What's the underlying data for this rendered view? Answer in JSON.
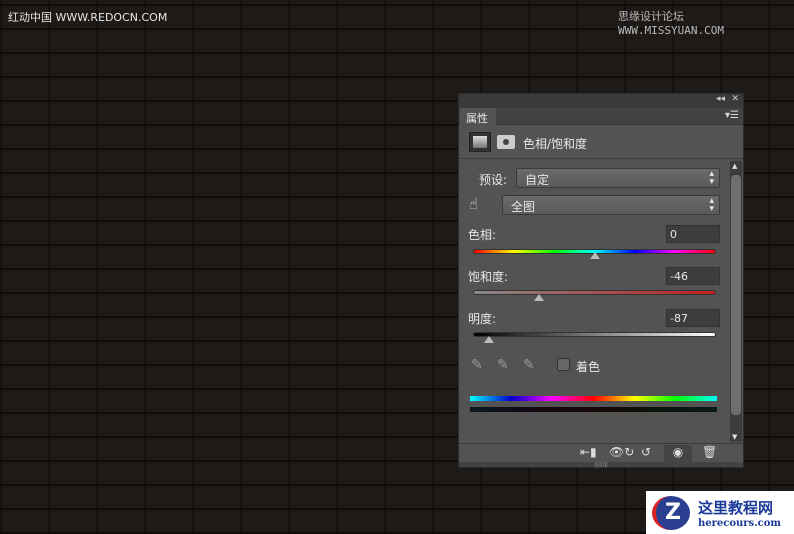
{
  "watermarks": {
    "left": "红动中国 WWW.REDOCN.COM",
    "right": "思缘设计论坛 WWW.MISSYUAN.COM",
    "logo_cn": "这里教程网",
    "logo_url": "herecours.com"
  },
  "panel": {
    "tab": "属性",
    "title": "色相/饱和度",
    "preset_label": "预设:",
    "preset_value": "自定",
    "channel_value": "全图",
    "hue_label": "色相:",
    "hue_value": "0",
    "hue": 0,
    "saturation_label": "饱和度:",
    "saturation_value": "-46",
    "saturation": -46,
    "lightness_label": "明度:",
    "lightness_value": "-87",
    "lightness": -87,
    "colorize_label": "着色"
  }
}
